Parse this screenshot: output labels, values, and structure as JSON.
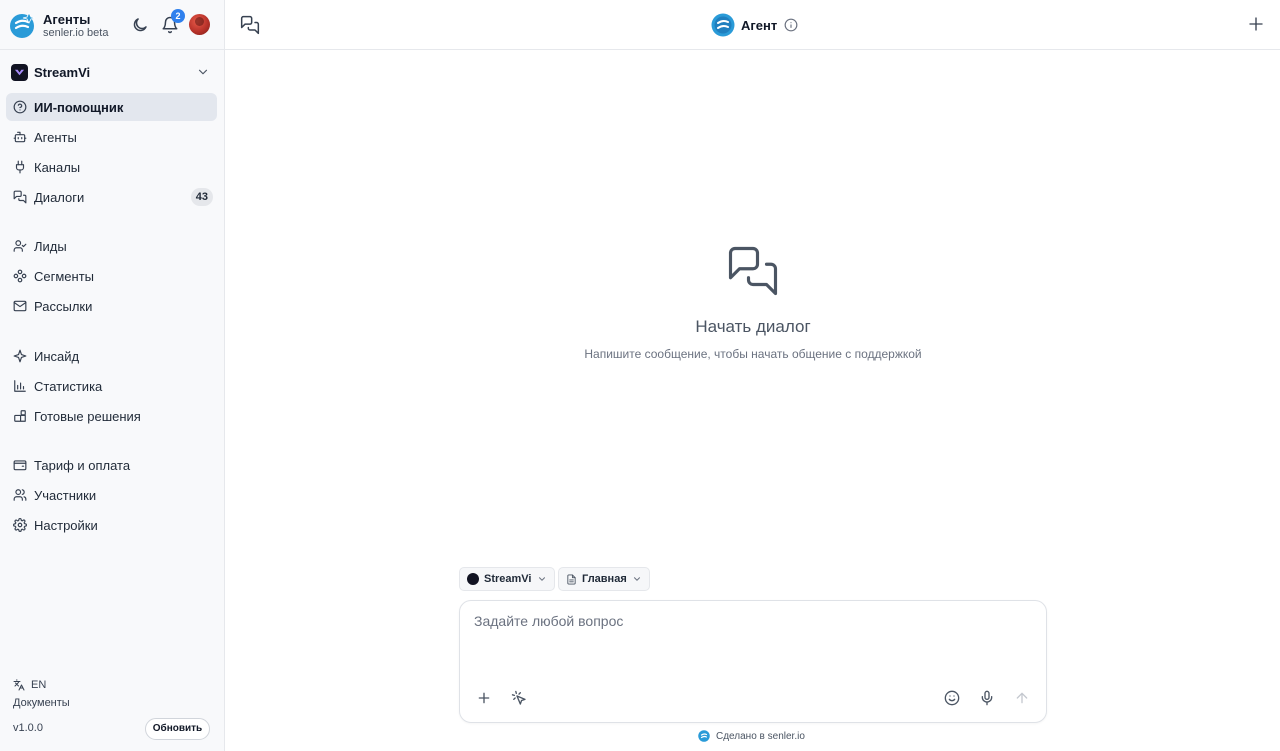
{
  "app": {
    "title": "Агенты",
    "subtitle": "senler.io beta",
    "notification_count": "2"
  },
  "workspace": {
    "name": "StreamVi"
  },
  "nav": [
    {
      "label": "ИИ-помощник",
      "icon": "help-circle-icon",
      "active": true
    },
    {
      "label": "Агенты",
      "icon": "bot-icon"
    },
    {
      "label": "Каналы",
      "icon": "plug-icon"
    },
    {
      "label": "Диалоги",
      "icon": "chat-bubbles-icon",
      "badge": "43"
    },
    {
      "label": "Лиды",
      "icon": "user-check-icon"
    },
    {
      "label": "Сегменты",
      "icon": "segments-icon"
    },
    {
      "label": "Рассылки",
      "icon": "mail-icon"
    },
    {
      "label": "Инсайд",
      "icon": "sparkle-icon"
    },
    {
      "label": "Статистика",
      "icon": "bar-chart-icon"
    },
    {
      "label": "Готовые решения",
      "icon": "blocks-icon"
    },
    {
      "label": "Тариф и оплата",
      "icon": "wallet-icon"
    },
    {
      "label": "Участники",
      "icon": "users-icon"
    },
    {
      "label": "Настройки",
      "icon": "gear-icon"
    }
  ],
  "sidebar_footer": {
    "lang": "EN",
    "docs": "Документы",
    "version": "v1.0.0",
    "update": "Обновить"
  },
  "topbar": {
    "title": "Агент"
  },
  "empty_state": {
    "title": "Начать диалог",
    "subtitle": "Напишите сообщение, чтобы начать общение с поддержкой"
  },
  "composer": {
    "workspace_chip": "StreamVi",
    "page_chip": "Главная",
    "placeholder": "Задайте любой вопрос"
  },
  "footer": {
    "text": "Сделано в senler.io"
  },
  "colors": {
    "accent": "#2f80ed",
    "active_bg": "#e3e7ee",
    "sidebar_bg": "#f8f9fb"
  }
}
